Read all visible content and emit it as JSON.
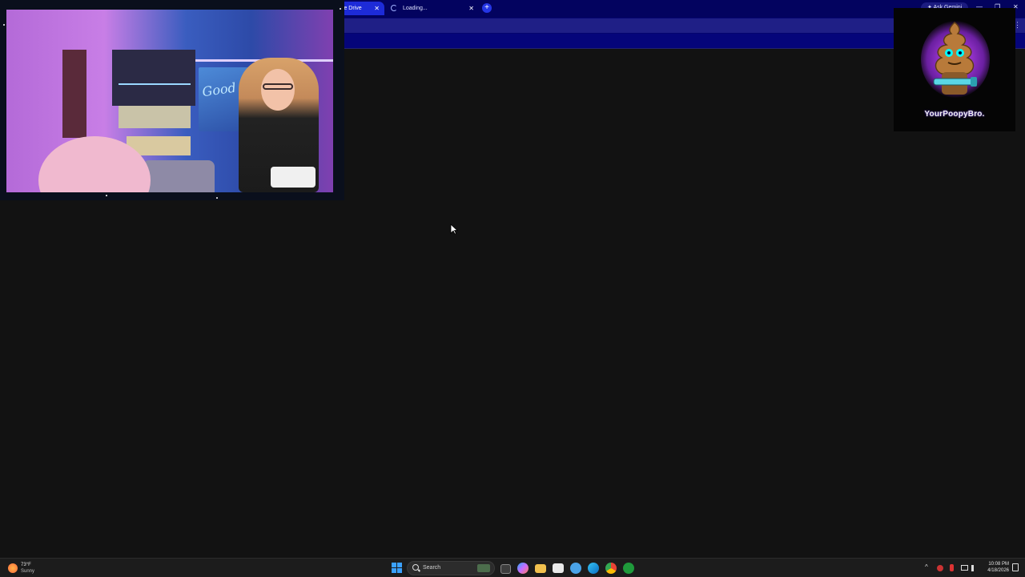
{
  "browser": {
    "tabs": [
      {
        "label": "gle Drive",
        "active": true
      },
      {
        "label": "Loading...",
        "active": false
      }
    ],
    "new_tab_label": "+",
    "close_glyph": "✕",
    "ask_gemini_label": "Ask Gemini",
    "window_controls": [
      "—",
      "❐",
      "✕"
    ],
    "menu_glyph": "⋮",
    "theme_color": "#04046e",
    "active_tab_color": "#1d2bd8"
  },
  "overlays": {
    "webcam": {
      "sign_text": "Good Vibes Only"
    },
    "logo": {
      "text": "YourPoopyBro."
    }
  },
  "taskbar": {
    "weather": {
      "temp": "73°F",
      "condition": "Sunny"
    },
    "search_label": "Search",
    "clock": {
      "time": "10:08 PM",
      "date": "4/18/2026"
    },
    "tray_chevron": "^",
    "pinned_icons": [
      "start-icon",
      "search-box",
      "task-view-icon",
      "copilot-icon",
      "file-explorer-icon",
      "store-icon",
      "search-app-icon",
      "edge-icon",
      "chrome-icon",
      "xbox-icon"
    ]
  }
}
